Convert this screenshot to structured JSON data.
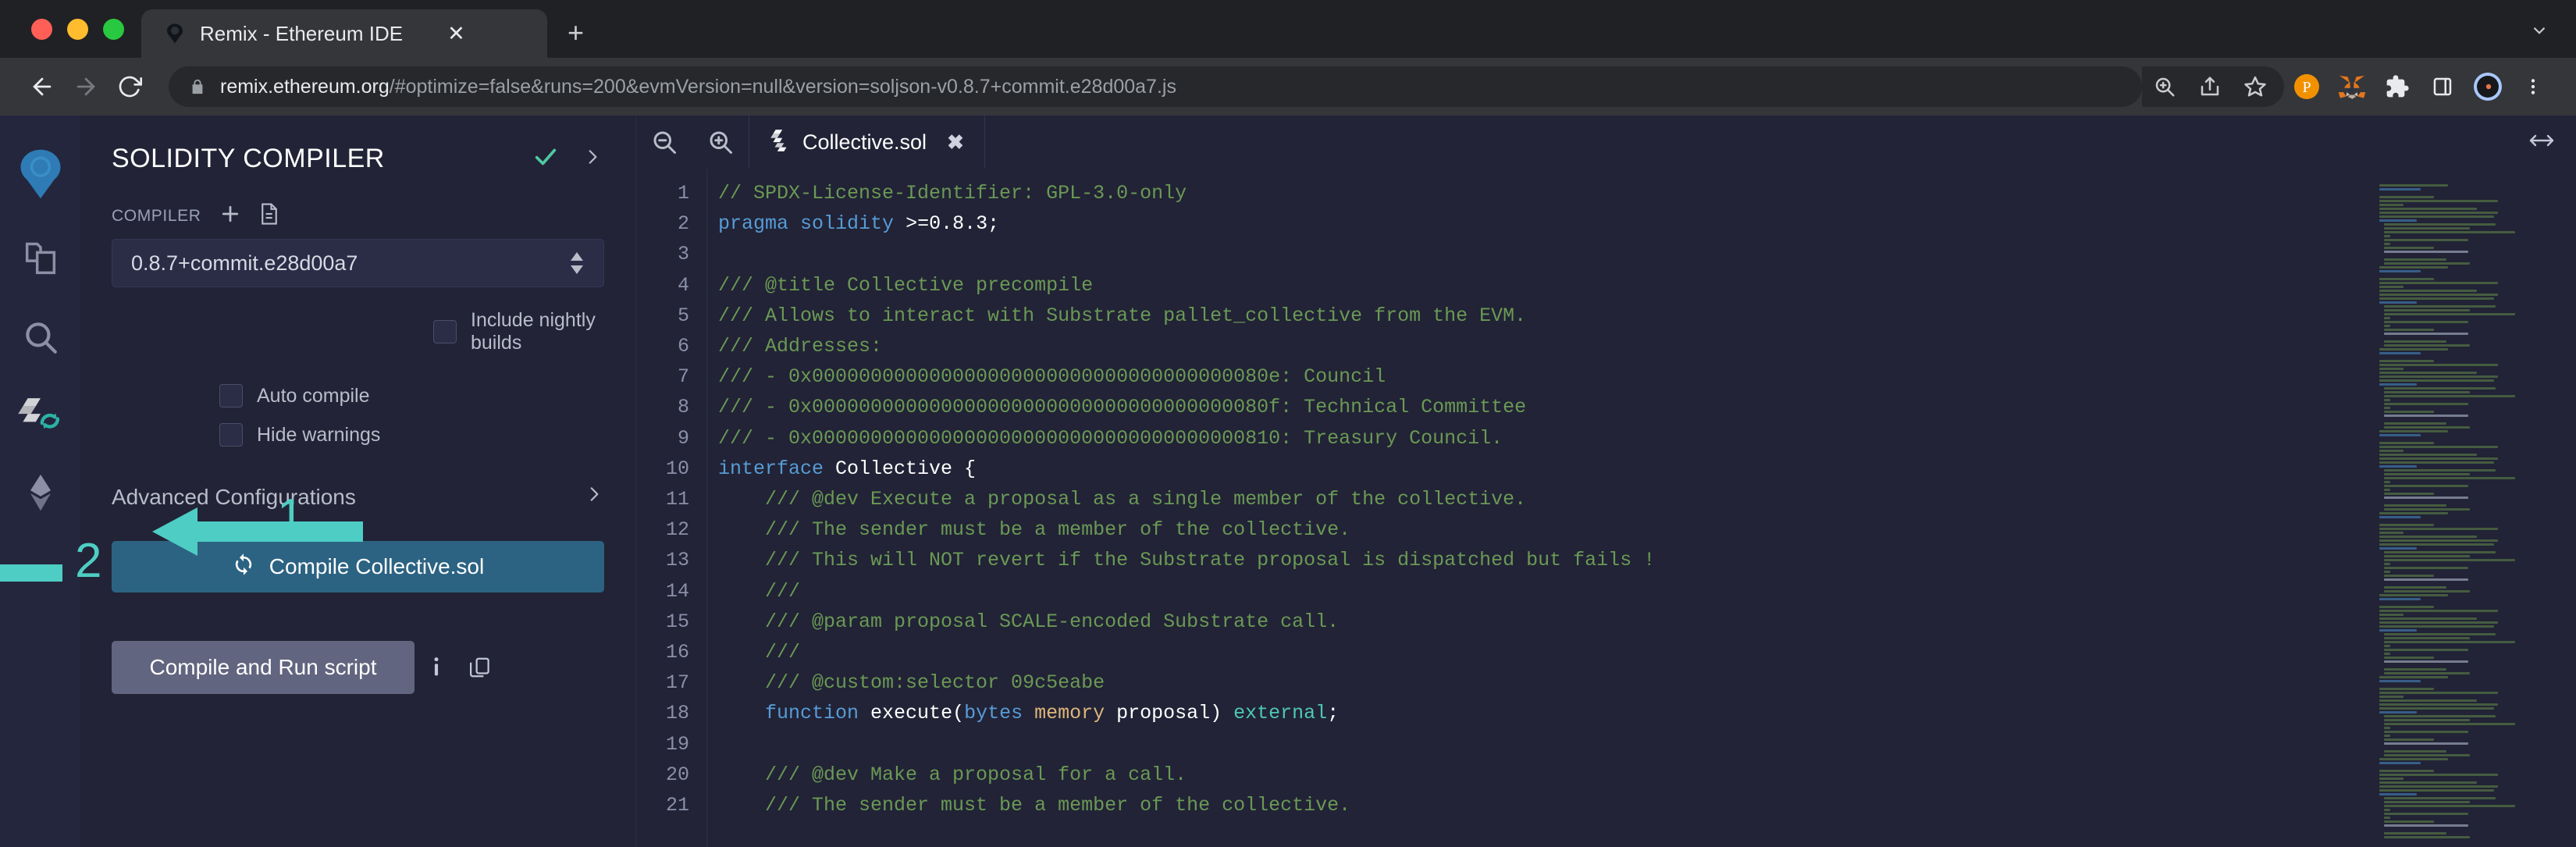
{
  "browser": {
    "tab": {
      "title": "Remix - Ethereum IDE",
      "favicon_icon": "remix-logo-icon",
      "close_icon": "close-icon"
    },
    "new_tab_icon": "plus-icon",
    "tabstrip_chevron_icon": "chevron-down-icon",
    "nav": {
      "back_icon": "back-arrow-icon",
      "forward_icon": "forward-arrow-icon",
      "reload_icon": "reload-icon"
    },
    "omnibox": {
      "lock_icon": "lock-icon",
      "host": "remix.ethereum.org",
      "path": "/#optimize=false&runs=200&evmVersion=null&version=soljson-v0.8.7+commit.e28d00a7.js"
    },
    "toolbar_icons": [
      "zoom-search-icon",
      "share-icon",
      "bookmark-star-icon",
      "polkadot-extension-icon",
      "metamask-fox-icon",
      "extensions-puzzle-icon",
      "side-panel-icon",
      "profile-avatar-icon",
      "browser-menu-icon"
    ]
  },
  "remix": {
    "rail": [
      {
        "name": "remix-logo",
        "label": "Remix"
      },
      {
        "name": "file-explorer",
        "label": "File explorers"
      },
      {
        "name": "search",
        "label": "Search in files"
      },
      {
        "name": "solidity-compiler",
        "label": "Solidity compiler"
      },
      {
        "name": "deploy-run",
        "label": "Deploy & run transactions"
      }
    ],
    "panel": {
      "title": "SOLIDITY COMPILER",
      "check_icon": "check-icon",
      "chevron_icon": "chevron-right-icon",
      "compiler_label": "COMPILER",
      "add_icon": "plus-icon",
      "file_icon": "file-icon",
      "compiler_version": "0.8.7+commit.e28d00a7",
      "nightly_label": "Include nightly builds",
      "autocompile_label": "Auto compile",
      "hidewarnings_label": "Hide warnings",
      "advanced_label": "Advanced Configurations",
      "advanced_chevron_icon": "chevron-right-icon",
      "compile_button": {
        "label": "Compile Collective.sol",
        "icon": "refresh-icon",
        "color": "#2c6382"
      },
      "run_script_button": {
        "label": "Compile and Run script",
        "color": "#62657f"
      },
      "info_icon": "info-icon",
      "copy_icon": "copy-icon"
    },
    "editor": {
      "zoom_out_icon": "zoom-out-icon",
      "zoom_in_icon": "zoom-in-icon",
      "resize_icon": "horizontal-resize-icon",
      "tab": {
        "name": "Collective.sol",
        "file_icon": "solidity-file-icon",
        "close_icon": "close-icon"
      },
      "first_line_number": 1,
      "lines": [
        {
          "n": 1,
          "tokens": [
            {
              "t": "// SPDX-License-Identifier: GPL-3.0-only",
              "c": "tok-c"
            }
          ]
        },
        {
          "n": 2,
          "tokens": [
            {
              "t": "pragma",
              "c": "tok-k"
            },
            {
              "t": " ",
              "c": "tok-w"
            },
            {
              "t": "solidity",
              "c": "tok-k"
            },
            {
              "t": " ",
              "c": "tok-w"
            },
            {
              "t": ">=0.8.3;",
              "c": "tok-n"
            }
          ]
        },
        {
          "n": 3,
          "tokens": [
            {
              "t": "",
              "c": "tok-w"
            }
          ]
        },
        {
          "n": 4,
          "tokens": [
            {
              "t": "/// @title Collective precompile",
              "c": "tok-c"
            }
          ]
        },
        {
          "n": 5,
          "tokens": [
            {
              "t": "/// Allows to interact with Substrate pallet_collective from the EVM.",
              "c": "tok-c"
            }
          ]
        },
        {
          "n": 6,
          "tokens": [
            {
              "t": "/// Addresses:",
              "c": "tok-c"
            }
          ]
        },
        {
          "n": 7,
          "tokens": [
            {
              "t": "/// - 0x000000000000000000000000000000000000080e: Council",
              "c": "tok-c"
            }
          ]
        },
        {
          "n": 8,
          "tokens": [
            {
              "t": "/// - 0x000000000000000000000000000000000000080f: Technical Committee",
              "c": "tok-c"
            }
          ]
        },
        {
          "n": 9,
          "tokens": [
            {
              "t": "/// - 0x0000000000000000000000000000000000000810: Treasury Council.",
              "c": "tok-c"
            }
          ]
        },
        {
          "n": 10,
          "tokens": [
            {
              "t": "interface",
              "c": "tok-k"
            },
            {
              "t": " Collective {",
              "c": "tok-n"
            }
          ]
        },
        {
          "n": 11,
          "tokens": [
            {
              "t": "    /// @dev Execute a proposal as a single member of the collective.",
              "c": "tok-c"
            }
          ]
        },
        {
          "n": 12,
          "tokens": [
            {
              "t": "    /// The sender must be a member of the collective.",
              "c": "tok-c"
            }
          ]
        },
        {
          "n": 13,
          "tokens": [
            {
              "t": "    /// This will NOT revert if the Substrate proposal is dispatched but fails !",
              "c": "tok-c"
            }
          ]
        },
        {
          "n": 14,
          "tokens": [
            {
              "t": "    ///",
              "c": "tok-c"
            }
          ]
        },
        {
          "n": 15,
          "tokens": [
            {
              "t": "    /// @param proposal SCALE-encoded Substrate call.",
              "c": "tok-c"
            }
          ]
        },
        {
          "n": 16,
          "tokens": [
            {
              "t": "    ///",
              "c": "tok-c"
            }
          ]
        },
        {
          "n": 17,
          "tokens": [
            {
              "t": "    /// @custom:selector 09c5eabe",
              "c": "tok-c"
            }
          ]
        },
        {
          "n": 18,
          "tokens": [
            {
              "t": "    ",
              "c": "tok-w"
            },
            {
              "t": "function",
              "c": "tok-k"
            },
            {
              "t": " execute(",
              "c": "tok-n"
            },
            {
              "t": "bytes",
              "c": "tok-k"
            },
            {
              "t": " ",
              "c": "tok-w"
            },
            {
              "t": "memory",
              "c": "tok-o"
            },
            {
              "t": " proposal) ",
              "c": "tok-n"
            },
            {
              "t": "external",
              "c": "tok-t"
            },
            {
              "t": ";",
              "c": "tok-n"
            }
          ]
        },
        {
          "n": 19,
          "tokens": [
            {
              "t": "",
              "c": "tok-w"
            }
          ]
        },
        {
          "n": 20,
          "tokens": [
            {
              "t": "    /// @dev Make a proposal for a call.",
              "c": "tok-c"
            }
          ]
        },
        {
          "n": 21,
          "tokens": [
            {
              "t": "    /// The sender must be a member of the collective.",
              "c": "tok-c"
            }
          ]
        }
      ]
    },
    "annotations": [
      {
        "label": "1",
        "target": "auto-compile-and-hide-warnings-checkboxes"
      },
      {
        "label": "2",
        "target": "compile-button"
      }
    ]
  },
  "colors": {
    "accent_teal": "#4ecdc4",
    "compile_blue": "#2c6382",
    "run_script_gray": "#62657f",
    "panel_bg": "#222336",
    "rail_bg": "#24263d",
    "comment_green": "#6a9955",
    "keyword_blue": "#569cd6"
  }
}
